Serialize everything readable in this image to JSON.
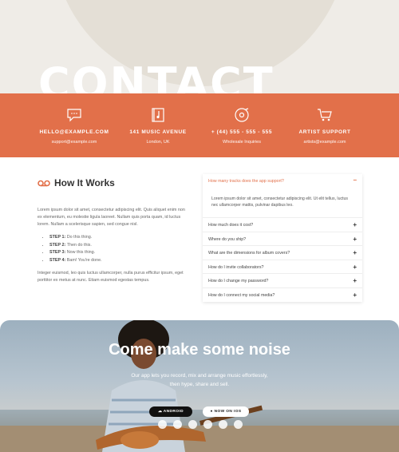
{
  "hero": {
    "title": "CONTACT"
  },
  "contacts": [
    {
      "icon": "chat-icon",
      "title": "HELLO@EXAMPLE.COM",
      "subtitle": "support@example.com"
    },
    {
      "icon": "music-book-icon",
      "title": "141 MUSIC AVENUE",
      "subtitle": "London, UK"
    },
    {
      "icon": "vinyl-record-icon",
      "title": "+ (44) 555 - 555 - 555",
      "subtitle": "Wholesale Inquiries"
    },
    {
      "icon": "cart-icon",
      "title": "ARTIST SUPPORT",
      "subtitle": "artists@example.com"
    }
  ],
  "how": {
    "title": "How It Works",
    "para1": "Lorem ipsum dolor sit amet, consectetur adipiscing elit. Quis aliquet enim non ex elementum, eu molestie ligula laoreet. Nullam quis porta quam, id luctus lorem. Nullam a scelerisque sapien, sed congue nisl.",
    "steps": [
      {
        "label": "STEP 1:",
        "text": "Do this thing."
      },
      {
        "label": "STEP 2:",
        "text": "Then do this."
      },
      {
        "label": "STEP 3:",
        "text": "Now this thing."
      },
      {
        "label": "STEP 4:",
        "text": "Bam! You're done."
      }
    ],
    "para2": "Integer euismod, leo quis luctus ullamcorper, nulla purus efficitur ipsum, eget porttitor ex metus at nunc. Etiam euismod egestas tempus."
  },
  "faq": {
    "open": {
      "question": "How many tracks does the app support?",
      "answer": "Lorem ipsum dolor sit amet, consectetur adipiscing elit. Ut elit tellus, luctus nec ullamcorper mattis, pulvinar dapibus leo."
    },
    "items": [
      "How much does it cost?",
      "Where do you ship?",
      "What are the dimensions for album covers?",
      "How do I invite collaborators?",
      "How do I change my password?",
      "How do I connect my social media?"
    ]
  },
  "cta": {
    "title": "Come make some noise",
    "subtitle": "Our app lets you record, mix and arrange music effortlessly, then hype, share and sell.",
    "android_label": "ANDROID",
    "ios_label": "NOW ON IOS",
    "social": [
      "facebook-icon",
      "twitter-icon",
      "soundcloud-icon",
      "spotify-icon",
      "lastfm-icon",
      "youtube-icon"
    ]
  },
  "colors": {
    "accent": "#e2704a"
  }
}
